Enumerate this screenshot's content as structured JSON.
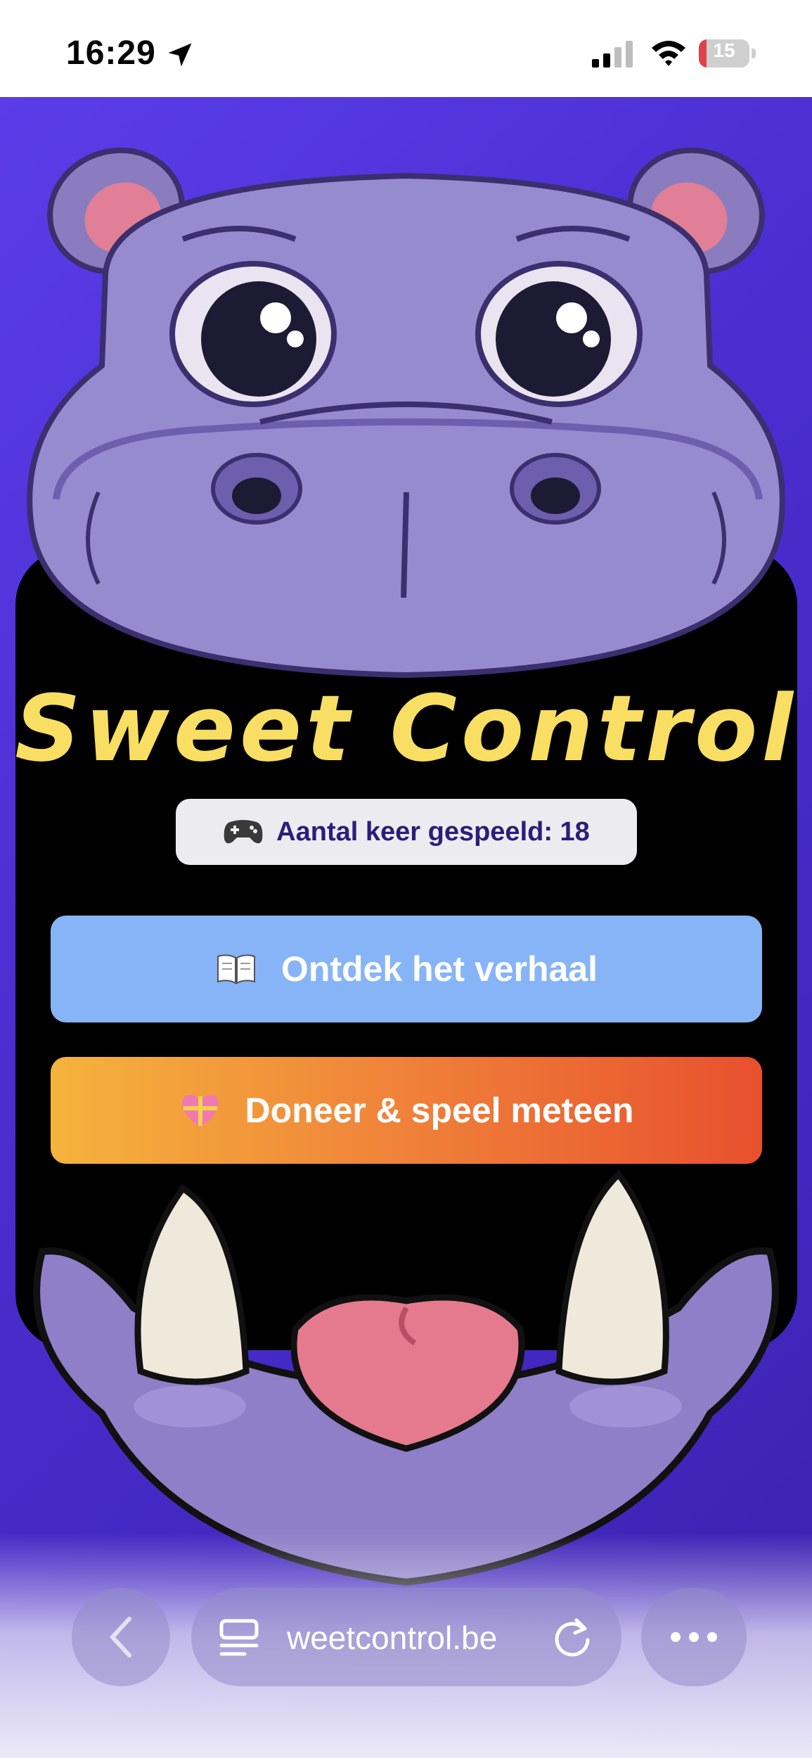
{
  "status_bar": {
    "time": "16:29",
    "battery_level": "15",
    "battery_fraction": 0.15,
    "battery_color": "#e0424a"
  },
  "page": {
    "title": "Sweet Control",
    "counter_icon": "game-controller-icon",
    "counter_text": "Aantal keer gespeeld: 18",
    "buttons": [
      {
        "icon": "open-book-icon",
        "label": "Ontdek het verhaal",
        "color": "#86b4f6"
      },
      {
        "icon": "gift-heart-icon",
        "label": "Doneer & speel meteen",
        "color": "#f0863a"
      }
    ],
    "accent_title_color": "#f8de63"
  },
  "browser": {
    "url": "weetcontrol.be",
    "back_icon": "chevron-left-icon",
    "page_icon": "page-format-icon",
    "reload_icon": "reload-icon",
    "more_icon": "more-icon"
  }
}
